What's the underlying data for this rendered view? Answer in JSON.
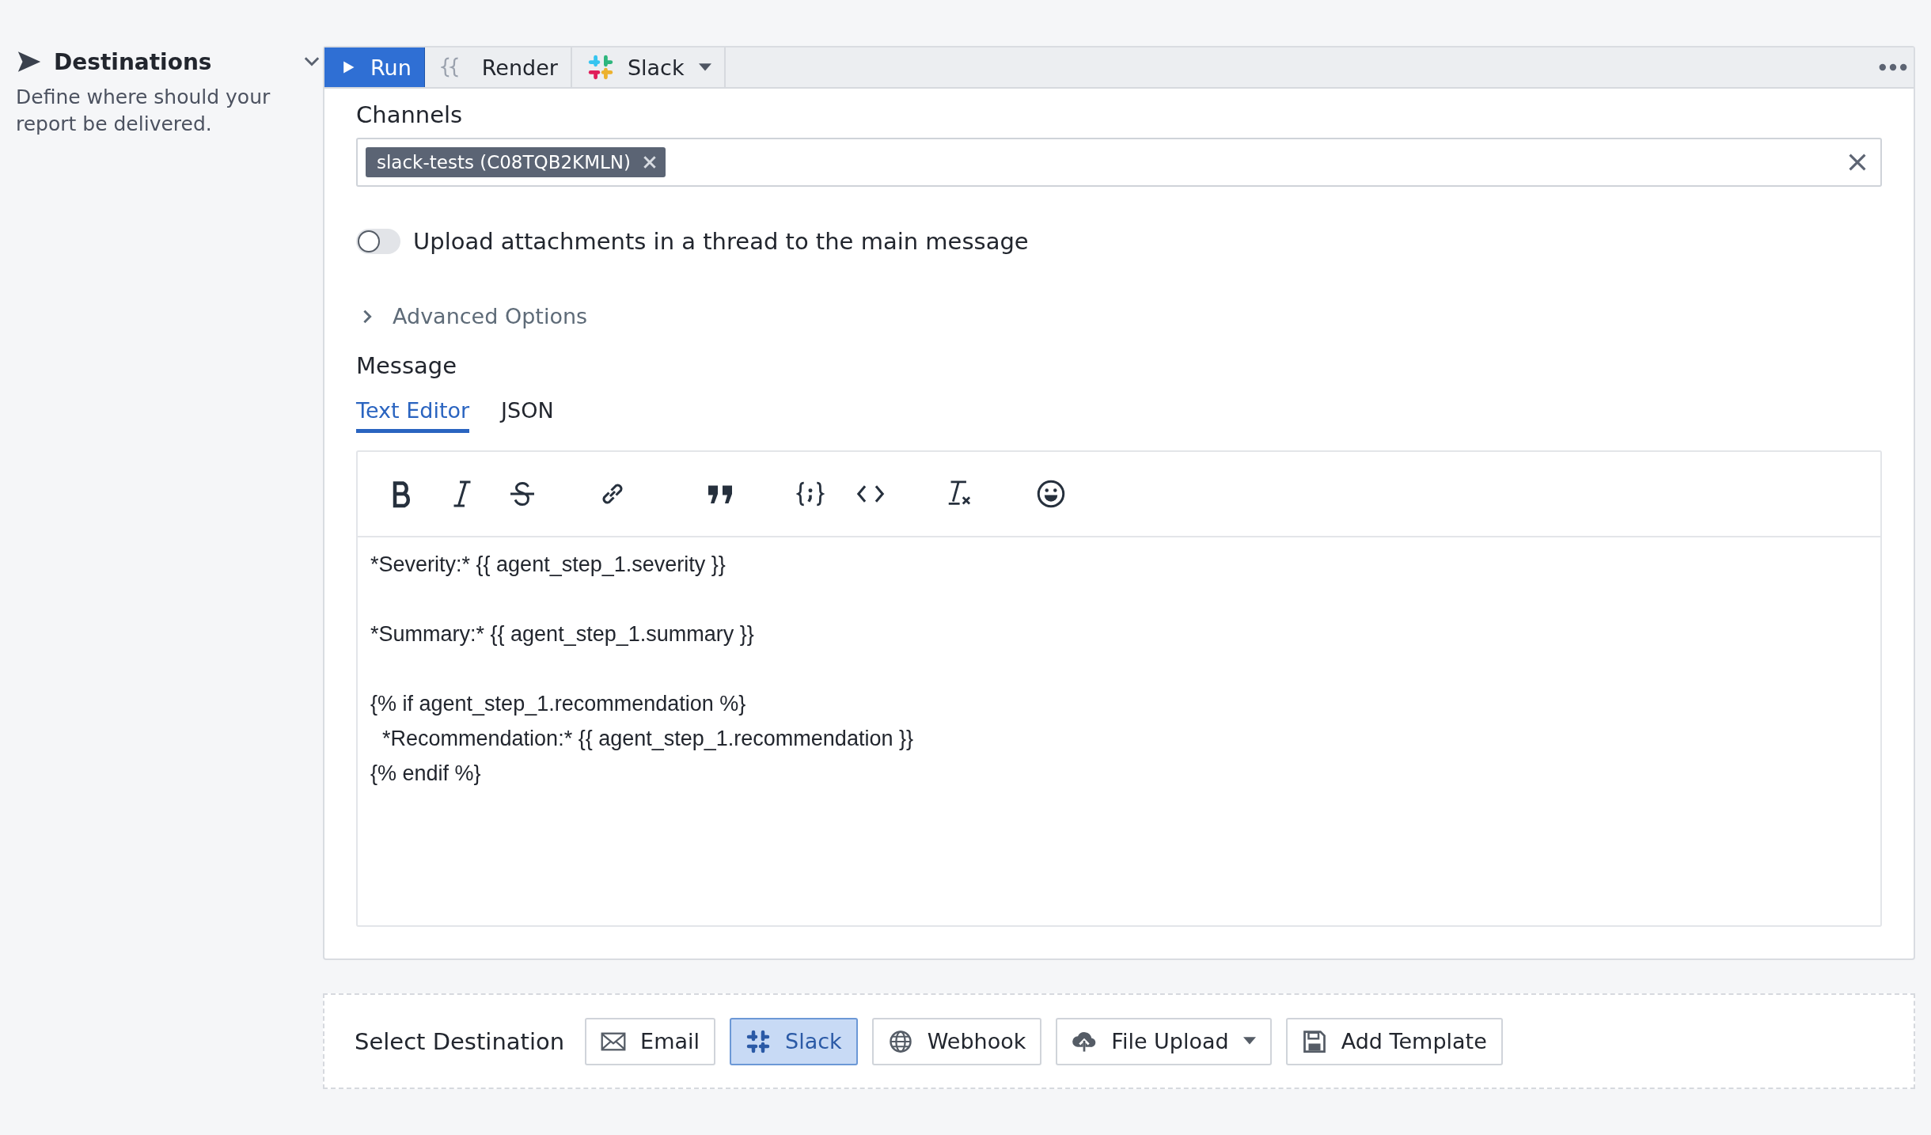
{
  "section": {
    "title": "Destinations",
    "description": "Define where should your report be delivered.",
    "expanded": true
  },
  "toolbar": {
    "run": "Run",
    "render": "Render",
    "destination": "Slack"
  },
  "channels": {
    "label": "Channels",
    "tags": [
      {
        "label": "slack-tests (C08TQB2KMLN)"
      }
    ]
  },
  "upload_in_thread": {
    "label": "Upload attachments in a thread to the main message",
    "on": false
  },
  "advanced_options": {
    "label": "Advanced Options",
    "expanded": false
  },
  "message": {
    "label": "Message",
    "tabs": [
      {
        "label": "Text Editor",
        "selected": true
      },
      {
        "label": "JSON",
        "selected": false
      }
    ],
    "format_tools": [
      {
        "kind": "bold"
      },
      {
        "kind": "italic"
      },
      {
        "kind": "strike"
      },
      {
        "kind": "link"
      },
      {
        "kind": "quote"
      },
      {
        "kind": "variable"
      },
      {
        "kind": "code"
      },
      {
        "kind": "clear"
      },
      {
        "kind": "emoji"
      }
    ],
    "text": "*Severity:* {{ agent_step_1.severity }}\n\n*Summary:* {{ agent_step_1.summary }}\n\n{% if agent_step_1.recommendation %}\n  *Recommendation:* {{ agent_step_1.recommendation }}\n{% endif %}"
  },
  "select_destination": {
    "label": "Select Destination",
    "buttons": [
      {
        "kind": "email",
        "label": "Email",
        "selected": false
      },
      {
        "kind": "slack",
        "label": "Slack",
        "selected": true
      },
      {
        "kind": "webhook",
        "label": "Webhook",
        "selected": false
      },
      {
        "kind": "upload",
        "label": "File Upload",
        "selected": false,
        "dropdown": true
      },
      {
        "kind": "template",
        "label": "Add Template",
        "selected": false
      }
    ]
  }
}
